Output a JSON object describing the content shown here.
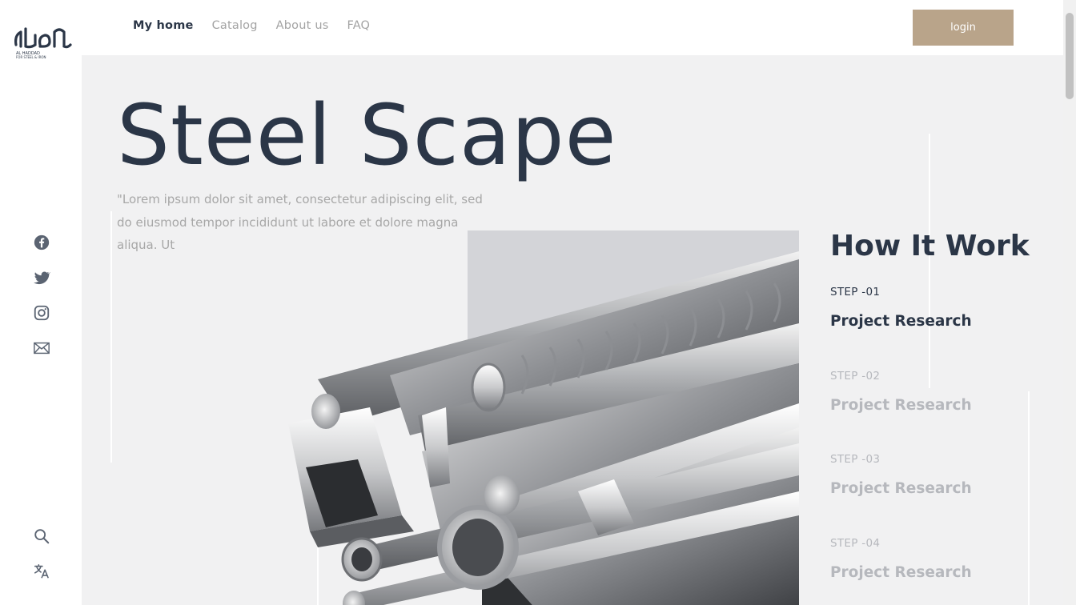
{
  "logo": {
    "alt": "Al Haddad logo"
  },
  "nav": {
    "items": [
      {
        "label": "My home",
        "active": true
      },
      {
        "label": "Catalog",
        "active": false
      },
      {
        "label": "About us",
        "active": false
      },
      {
        "label": "FAQ",
        "active": false
      }
    ],
    "login_label": "login"
  },
  "hero": {
    "title": "Steel Scape",
    "description": "\"Lorem ipsum dolor sit amet, consectetur adipiscing elit, sed do eiusmod tempor incididunt ut labore et dolore magna aliqua. Ut"
  },
  "how": {
    "title": "How It Work",
    "steps": [
      {
        "label": "STEP -01",
        "name": "Project Research",
        "active": true
      },
      {
        "label": "STEP -02",
        "name": "Project Research",
        "active": false
      },
      {
        "label": "STEP -03",
        "name": "Project Research",
        "active": false
      },
      {
        "label": "STEP -04",
        "name": "Project Research",
        "active": false
      }
    ]
  },
  "sidebar": {
    "social_icons": [
      "facebook-icon",
      "twitter-icon",
      "instagram-icon",
      "mail-icon"
    ],
    "tool_icons": [
      "search-icon",
      "translate-icon"
    ]
  },
  "colors": {
    "accent": "#b9a48a",
    "text_dark": "#2b3647",
    "muted": "#b6b8bd",
    "hero_bg": "#f1f1f2"
  }
}
